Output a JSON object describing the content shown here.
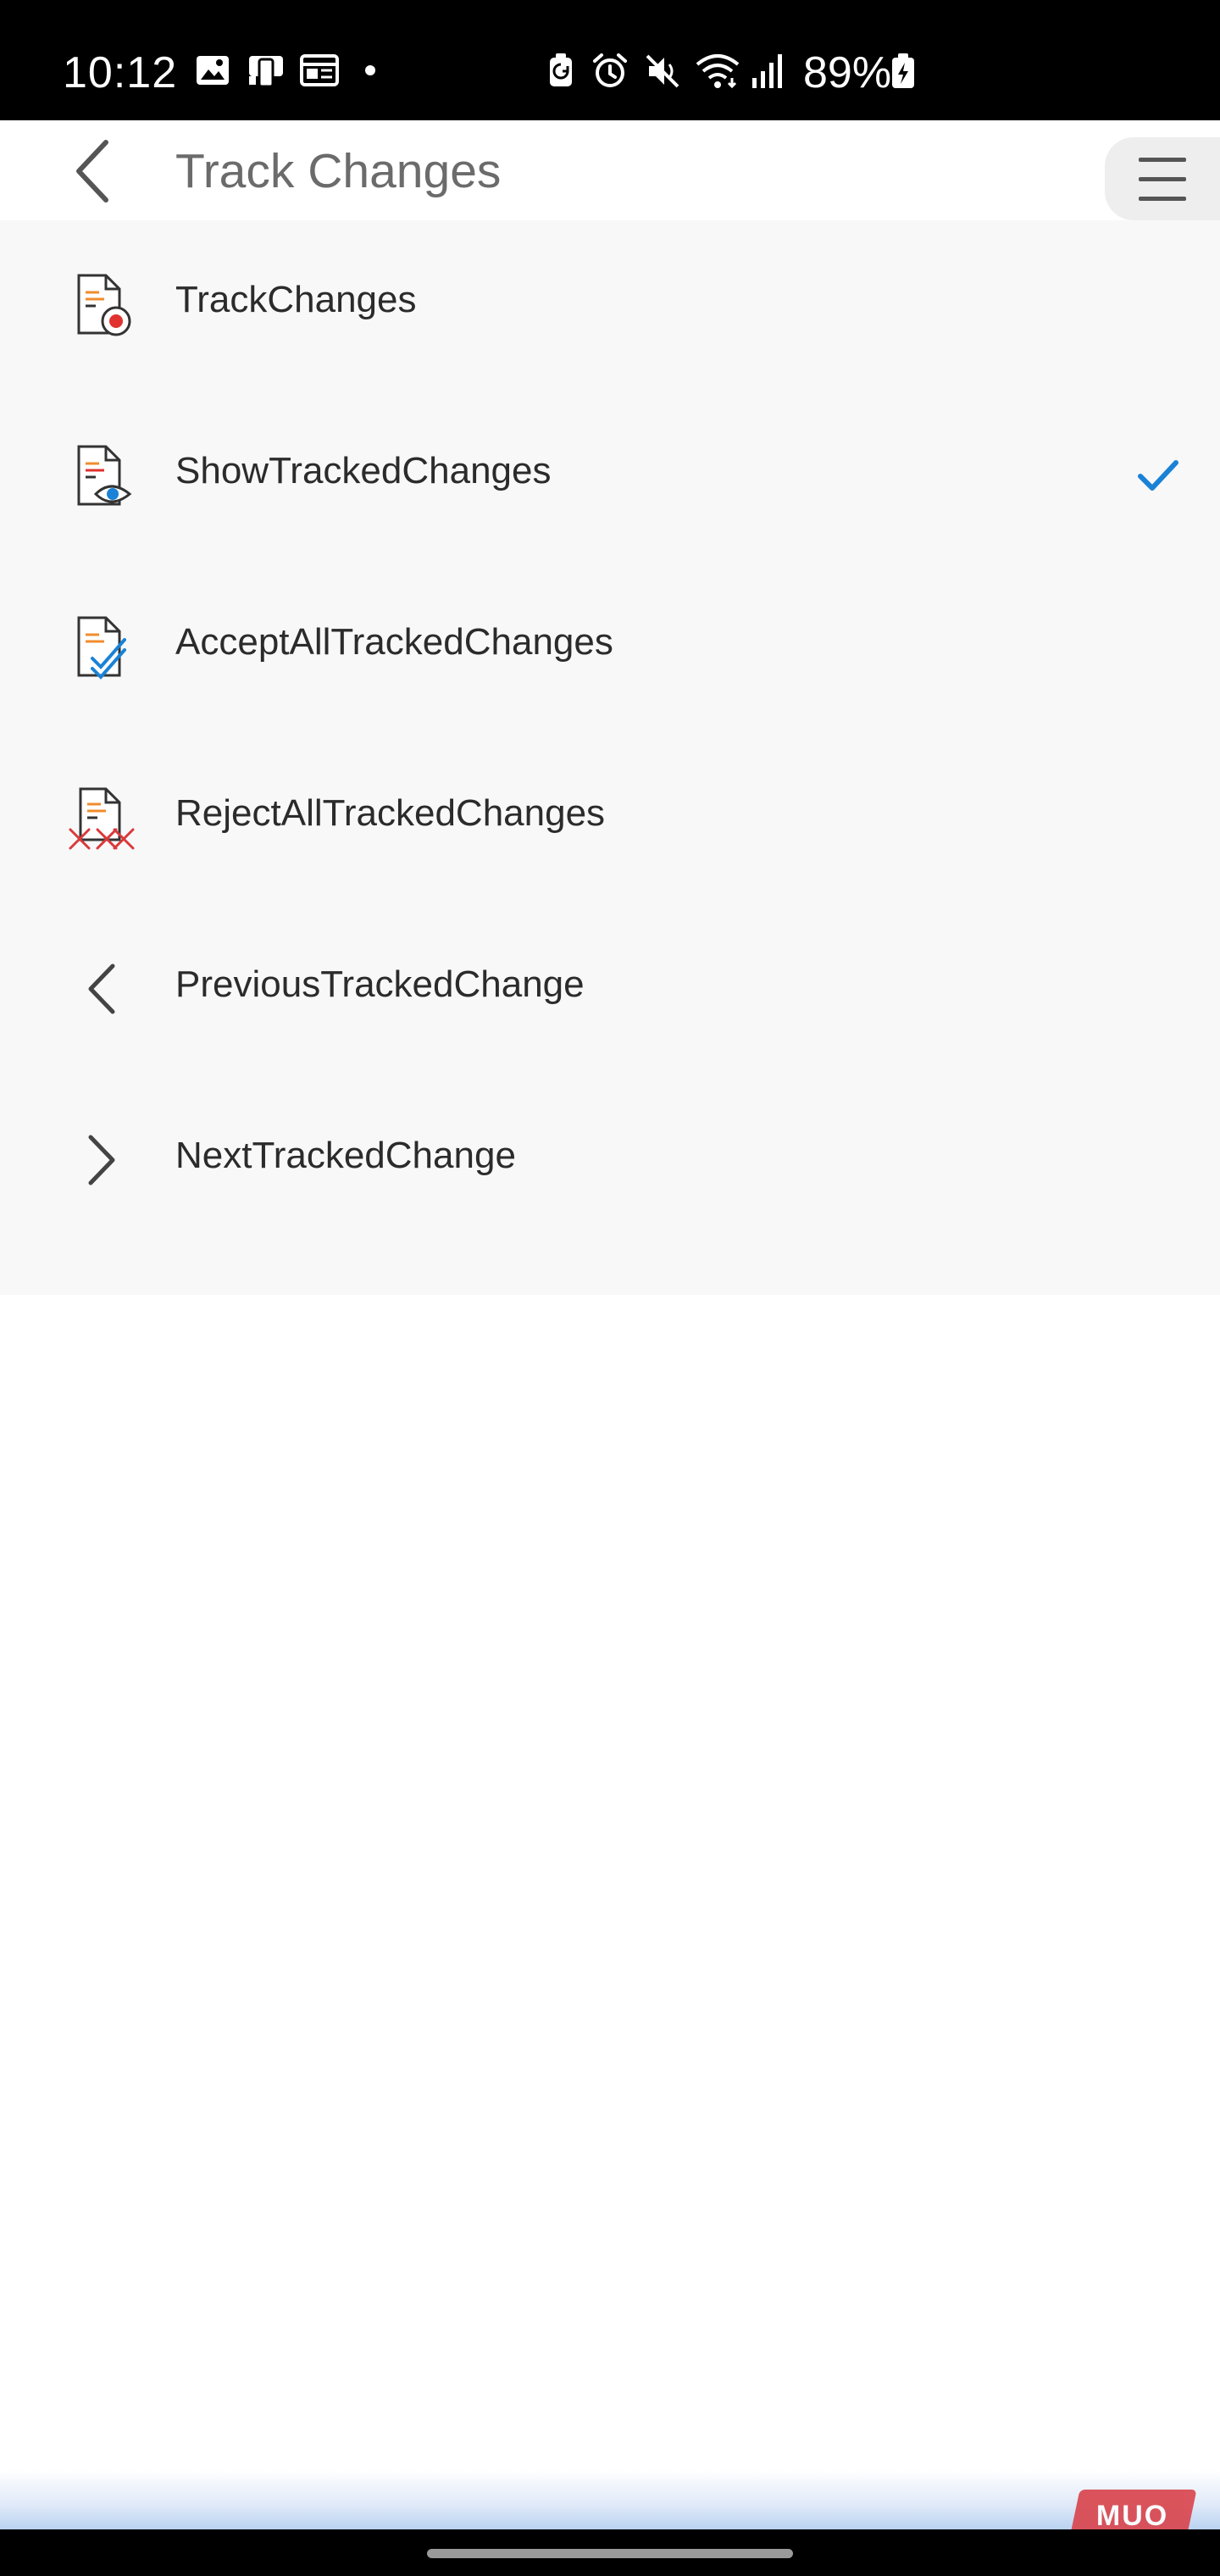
{
  "status_bar": {
    "time": "10:12",
    "battery_percent": "89%",
    "icons": [
      "gallery-icon",
      "device-icon",
      "news-icon",
      "dot-icon",
      "battery-saver-icon",
      "alarm-icon",
      "mute-icon",
      "wifi-icon",
      "signal-icon",
      "battery-charging-icon"
    ]
  },
  "app_bar": {
    "title": "Track Changes",
    "back_icon": "chevron-left-icon",
    "menu_icon": "hamburger-icon"
  },
  "menu": {
    "items": [
      {
        "label": "TrackChanges",
        "icon": "track-changes-icon",
        "checked": false
      },
      {
        "label": "ShowTrackedChanges",
        "icon": "show-tracked-changes-icon",
        "checked": true
      },
      {
        "label": "AcceptAllTrackedChanges",
        "icon": "accept-all-icon",
        "checked": false
      },
      {
        "label": "RejectAllTrackedChanges",
        "icon": "reject-all-icon",
        "checked": false
      },
      {
        "label": "PreviousTrackedChange",
        "icon": "chevron-left-icon",
        "checked": false
      },
      {
        "label": "NextTrackedChange",
        "icon": "chevron-right-icon",
        "checked": false
      }
    ]
  },
  "watermark": {
    "text": "MUO"
  },
  "colors": {
    "accent_blue": "#1a82d6",
    "record_red": "#e0322f",
    "reject_red": "#d9393b",
    "doc_orange": "#f08c2e",
    "menu_background": "#f8f8f8"
  }
}
